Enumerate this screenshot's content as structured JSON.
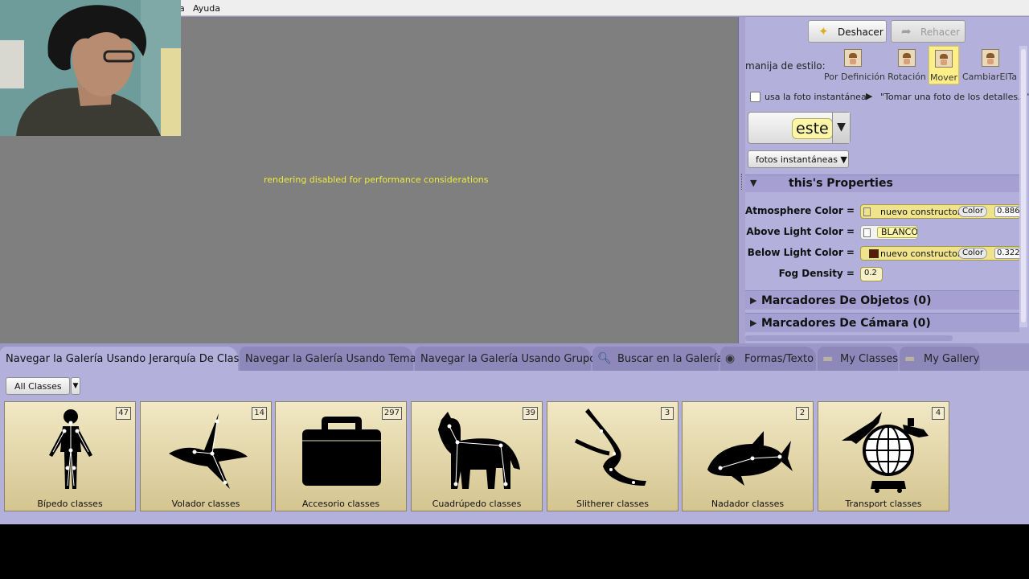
{
  "menu": {
    "visible_fragment": "a",
    "help": "Ayuda"
  },
  "scene": {
    "message": "rendering disabled for performance considerations"
  },
  "toolbar": {
    "undo_label": "Deshacer",
    "redo_label": "Rehacer"
  },
  "style_handles": {
    "label": "manija de estilo:",
    "items": [
      {
        "label": "Por Definición",
        "selected": false
      },
      {
        "label": "Rotación",
        "selected": false
      },
      {
        "label": "Mover",
        "selected": true
      },
      {
        "label": "CambiarElTa",
        "selected": false
      }
    ]
  },
  "snapshot": {
    "checkbox_label": "usa la foto instantánea",
    "arrow": "▶",
    "detail_text": "\"Tomar una foto de los detalles...\""
  },
  "selector": {
    "value": "este",
    "dropdown": "▼"
  },
  "fotos_button": "fotos instantáneas ▼",
  "properties": {
    "title": "this's Properties",
    "toggle": "▼",
    "rows": [
      {
        "label": "Atmosphere Color =",
        "constructor": "nuevo constructor",
        "class": "Color",
        "number": "0.886"
      },
      {
        "label": "Above Light Color =",
        "value": "BLANCO"
      },
      {
        "label": "Below Light Color =",
        "constructor": "nuevo constructor",
        "class": "Color",
        "number": "0.322"
      },
      {
        "label": "Fog Density =",
        "number": "0.2"
      }
    ]
  },
  "markers": [
    {
      "label": "Marcadores De Objetos (0)",
      "toggle": "▶"
    },
    {
      "label": "Marcadores De Cámara (0)",
      "toggle": "▶"
    }
  ],
  "gallery": {
    "tabs": [
      {
        "label": "Navegar la Galería Usando Jerarquía De Clases",
        "active": true
      },
      {
        "label": "Navegar la Galería Usando Temas",
        "active": false
      },
      {
        "label": "Navegar la Galería Usando Grupos",
        "active": false
      },
      {
        "label": "Buscar en la Galería",
        "active": false,
        "icon": "magnifier-icon"
      },
      {
        "label": "Formas/Texto",
        "active": false,
        "icon": "shapes-icon"
      },
      {
        "label": "My Classes",
        "active": false,
        "icon": "folder-icon"
      },
      {
        "label": "My Gallery",
        "active": false,
        "icon": "folder-icon"
      }
    ],
    "filter": {
      "value": "All Classes",
      "dropdown": "▼"
    },
    "cards": [
      {
        "label": "Bípedo classes",
        "count": "47",
        "icon": "biped-icon"
      },
      {
        "label": "Volador classes",
        "count": "14",
        "icon": "flyer-icon"
      },
      {
        "label": "Accesorio classes",
        "count": "297",
        "icon": "toolbox-icon"
      },
      {
        "label": "Cuadrúpedo classes",
        "count": "39",
        "icon": "quadruped-icon"
      },
      {
        "label": "Slitherer classes",
        "count": "3",
        "icon": "slitherer-icon"
      },
      {
        "label": "Nadador classes",
        "count": "2",
        "icon": "swimmer-icon"
      },
      {
        "label": "Transport classes",
        "count": "4",
        "icon": "transport-icon"
      }
    ]
  },
  "colors": {
    "panel_bg": "#b4b0dc",
    "scene_bg": "#7f7f7f",
    "scene_text": "#ecec3a",
    "card_bg": "#e6dcae",
    "below_light_swatch": "#5a1a08"
  }
}
